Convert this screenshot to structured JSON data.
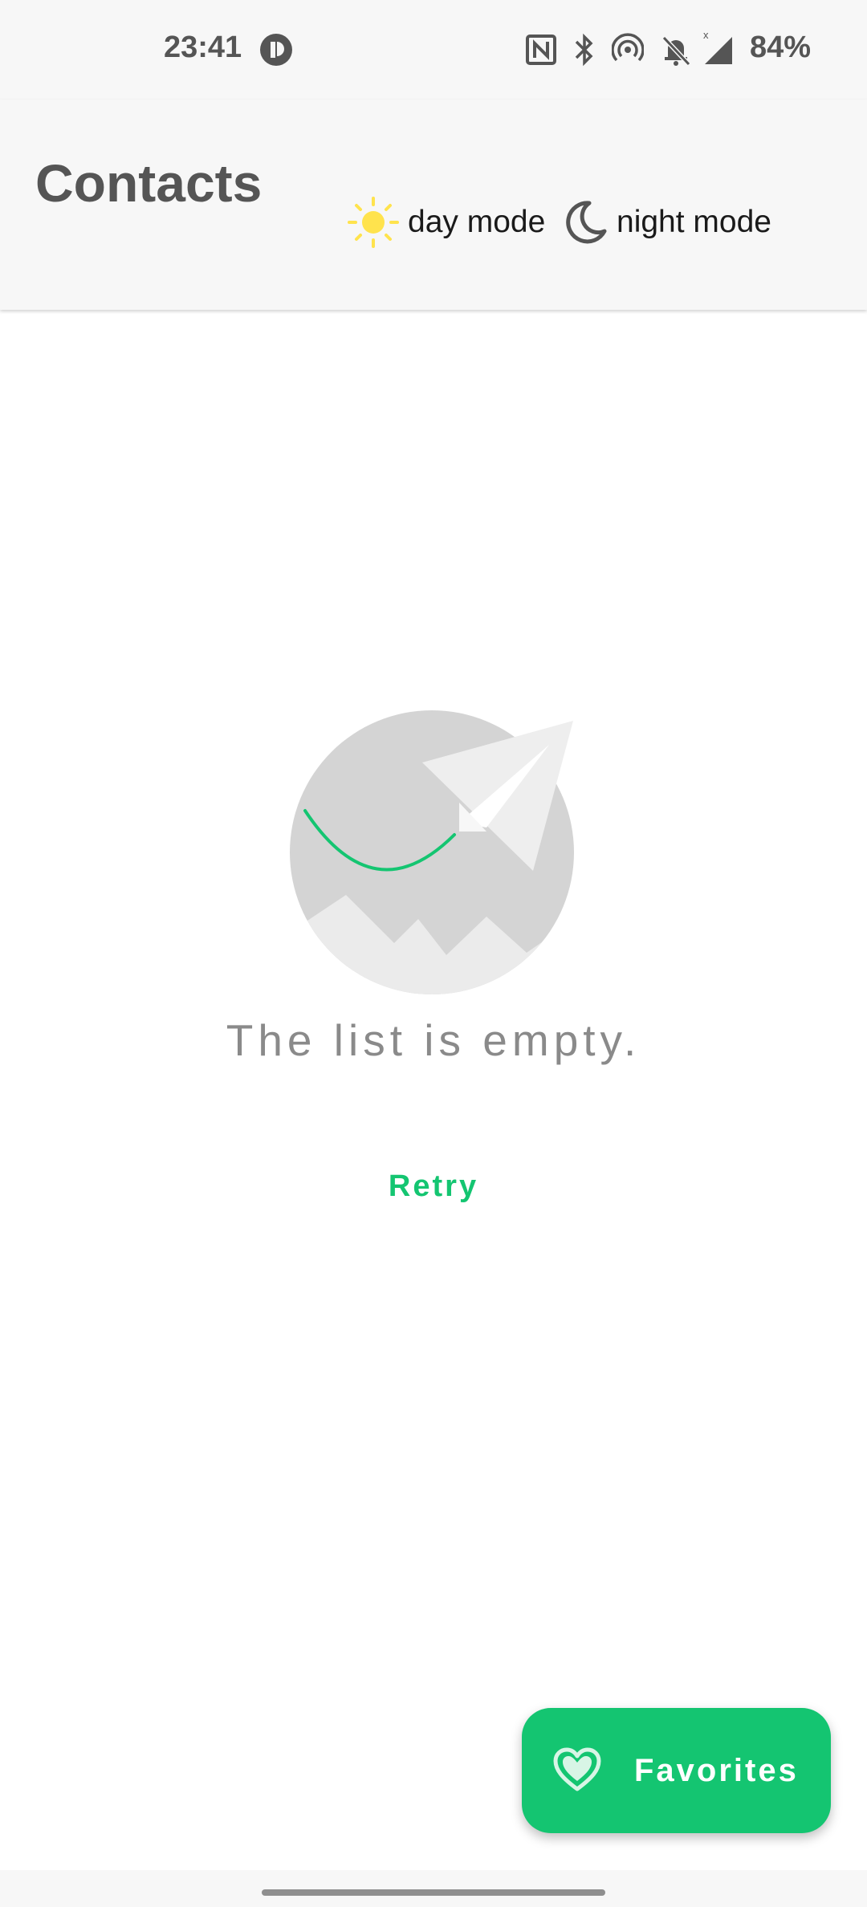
{
  "status_bar": {
    "time": "23:41",
    "battery": "84%",
    "icons": [
      "app-notification-icon",
      "nfc-icon",
      "bluetooth-icon",
      "hotspot-icon",
      "bell-off-icon",
      "signal-icon"
    ]
  },
  "app_bar": {
    "title": "Contacts",
    "day_mode_label": "day mode",
    "night_mode_label": "night mode"
  },
  "empty_state": {
    "message": "The list is empty.",
    "retry_label": "Retry"
  },
  "fab": {
    "label": "Favorites",
    "icon": "heart-icon"
  },
  "colors": {
    "accent": "#14c571",
    "sun": "#ffe34d",
    "text_dark": "#555555",
    "muted": "#8a8a8a",
    "bar_background": "#f7f7f7"
  }
}
